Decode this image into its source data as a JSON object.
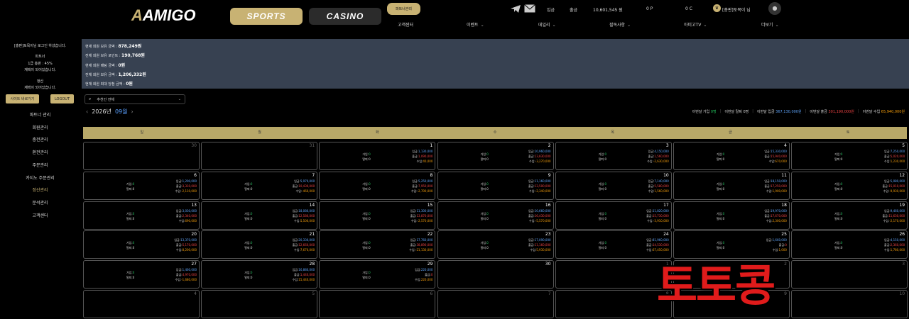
{
  "header": {
    "logo": "AMIGO",
    "sports": "SPORTS",
    "casino": "CASINO",
    "partner": "파트너관리",
    "deposit": "입금",
    "withdraw": "출금",
    "balance": "10,601,545 원",
    "points": "0 P",
    "coins": "0 C",
    "user": "[총판]토목이 님",
    "menu": [
      "고객센터",
      "이벤트",
      "데일리",
      "필독사항",
      "아미고TV",
      "더보기"
    ]
  },
  "sidebar": {
    "login_msg": "[총판]토목이님 로그인 하셨습니다.",
    "partner_title": "파트너",
    "partner_rate": "1급 총판 : 45%",
    "partner_status": "재택이 되어있습니다.",
    "settle_title": "정산",
    "settle_status": "재택이 되어있습니다.",
    "site_btn": "사이트 바로가기",
    "logout_btn": "LOGOUT",
    "items": [
      "파트너 관리",
      "회원관리",
      "충전관리",
      "환전관리",
      "주문관리",
      "카지노 주문관리",
      "정산관리",
      "분석관리",
      "고객센터"
    ],
    "active_index": 6
  },
  "summary": [
    {
      "label": "현재 회원 보유 금액 : ",
      "value": "878,249원"
    },
    {
      "label": "전체 회원 보유 포인트 : ",
      "value": "190,768원"
    },
    {
      "label": "현재 회원 배팅 금액 : ",
      "value": "0원"
    },
    {
      "label": "전체 회원 보유 금액 : ",
      "value": "1,206,332원"
    },
    {
      "label": "현재 회원 최대 당첨 금액 : ",
      "value": "0원"
    }
  ],
  "filter": {
    "selected": "추천인 전체"
  },
  "month": {
    "year": "2026년",
    "month": "09월"
  },
  "stats": [
    {
      "label": "이번달 가입",
      "value": "0명",
      "cls": "g"
    },
    {
      "label": "이번달 탈퇴",
      "value": "0명",
      "cls": ""
    },
    {
      "label": "이번달 입금",
      "value": "367,130,000원",
      "cls": "b"
    },
    {
      "label": "이번달 출금",
      "value": "301,190,000원",
      "cls": "r"
    },
    {
      "label": "이번달 수입",
      "value": "65,940,000원",
      "cls": "o"
    }
  ],
  "weekdays": [
    "일",
    "월",
    "화",
    "수",
    "목",
    "금",
    "토"
  ],
  "days": [
    {
      "d": "30",
      "off": true
    },
    {
      "d": "31",
      "off": true
    },
    {
      "d": "1",
      "in": "1,130,000",
      "out": "1,090,000",
      "net": "40,000"
    },
    {
      "d": "2",
      "in": "10,960,000",
      "out": "13,830,000",
      "net": "-3,270,000"
    },
    {
      "d": "3",
      "in": "4,150,000",
      "out": "1,560,000",
      "net": "-2,630,000"
    },
    {
      "d": "4",
      "in": "15,330,000",
      "out": "15,940,000",
      "net": "670,000"
    },
    {
      "d": "5",
      "in": "7,250,000",
      "out": "5,020,000",
      "net": "1,230,000"
    },
    {
      "d": "6",
      "in": "1,200,000",
      "out": "3,310,000",
      "net": "-2,110,000"
    },
    {
      "d": "7",
      "in": "5,970,000",
      "out": "10,430,000",
      "net": "-460,000"
    },
    {
      "d": "8",
      "in": "5,250,000",
      "out": "7,950,000",
      "net": "-2,700,000"
    },
    {
      "d": "9",
      "in": "11,160,000",
      "out": "13,500,000",
      "net": "-2,340,000"
    },
    {
      "d": "10",
      "in": "7,140,000",
      "out": "5,580,000",
      "net": "1,560,000"
    },
    {
      "d": "11",
      "in": "18,150,000",
      "out": "17,250,000",
      "net": "1,900,000"
    },
    {
      "d": "12",
      "in": "5,080,000",
      "out": "15,010,000",
      "net": "-9,930,000"
    },
    {
      "d": "13",
      "in": "3,030,000",
      "out": "2,340,000",
      "net": "690,000"
    },
    {
      "d": "14",
      "in": "18,080,000",
      "out": "12,580,000",
      "net": "5,500,000"
    },
    {
      "d": "15",
      "in": "11,300,000",
      "out": "13,870,000",
      "net": "-2,570,000"
    },
    {
      "d": "16",
      "in": "10,660,000",
      "out": "16,430,000",
      "net": "-5,570,000"
    },
    {
      "d": "17",
      "in": "11,820,000",
      "out": "15,730,000",
      "net": "-3,910,000"
    },
    {
      "d": "18",
      "in": "19,970,000",
      "out": "17,670,000",
      "net": "2,300,000"
    },
    {
      "d": "19",
      "in": "9,460,000",
      "out": "11,630,000",
      "net": "-2,170,000"
    },
    {
      "d": "20",
      "in": "13,370,000",
      "out": "5,170,000",
      "net": "8,200,000"
    },
    {
      "d": "21",
      "in": "20,330,000",
      "out": "12,660,000",
      "net": "7,670,000"
    },
    {
      "d": "22",
      "in": "17,760,000",
      "out": "38,890,000",
      "net": "-21,130,000"
    },
    {
      "d": "23",
      "in": "17,090,000",
      "out": "11,160,000",
      "net": "5,930,000"
    },
    {
      "d": "24",
      "in": "81,960,000",
      "out": "14,530,000",
      "net": "67,450,000"
    },
    {
      "d": "25",
      "in": "1,660,000",
      "out": "0",
      "net": "1,000"
    },
    {
      "d": "26",
      "in": "4,150,000",
      "out": "2,360,000",
      "net": "1,780,000"
    },
    {
      "d": "27",
      "in": "1,460,000",
      "out": "4,970,000",
      "net": "-1,680,000"
    },
    {
      "d": "28",
      "in": "16,880,000",
      "out": "1,440,000",
      "net": "15,440,000"
    },
    {
      "d": "29",
      "in": "220,000",
      "out": "0",
      "net": "220,000"
    },
    {
      "d": "30"
    },
    {
      "d": "1",
      "off": true
    },
    {
      "d": "2",
      "off": true
    },
    {
      "d": "3",
      "off": true
    },
    {
      "d": "4",
      "off": true
    },
    {
      "d": "5",
      "off": true
    },
    {
      "d": "6",
      "off": true
    },
    {
      "d": "7",
      "off": true
    },
    {
      "d": "8",
      "off": true
    },
    {
      "d": "9",
      "off": true
    },
    {
      "d": "10",
      "off": true
    }
  ],
  "cell_labels": {
    "join": "가입:",
    "quit": "탈퇴:",
    "in": "입금:",
    "out": "출금:",
    "net": "수입:",
    "zero": "0"
  },
  "watermark": "토토콩"
}
